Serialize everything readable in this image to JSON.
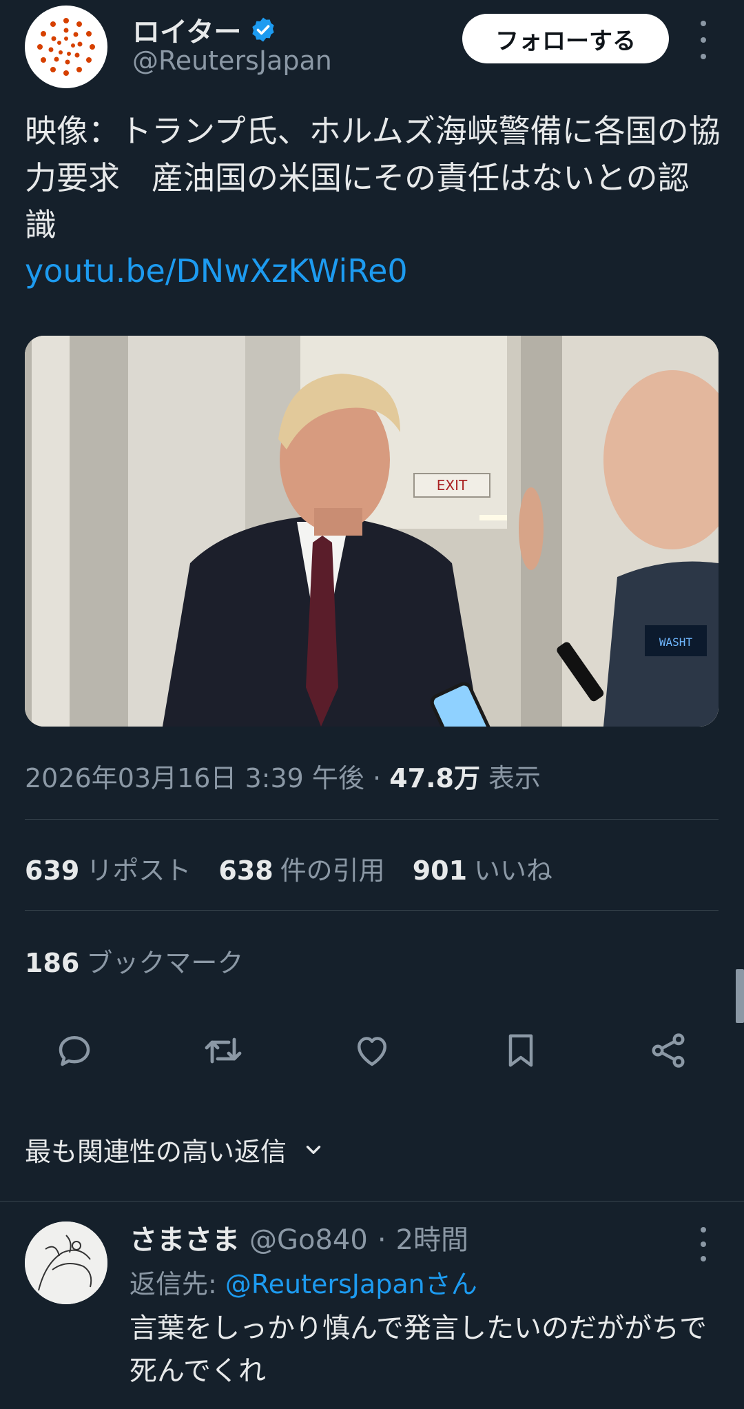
{
  "author": {
    "display_name": "ロイター",
    "handle": "@ReutersJapan",
    "verified": true,
    "follow_label": "フォローする",
    "brand_color": "#d64000"
  },
  "tweet": {
    "text": "映像：トランプ氏、ホルムズ海峡警備に各国の協力要求　産油国の米国にその責任はないとの認識",
    "link": "youtu.be/DNwXzKWiRe0",
    "media_sign_exit": "EXIT",
    "media_sign_screen": "WASHT",
    "timestamp": "2026年03月16日 3:39 午後",
    "separator": "·",
    "views_count": "47.8万",
    "views_label": "表示"
  },
  "stats": {
    "reposts": {
      "count": "639",
      "label": "リポスト"
    },
    "quotes": {
      "count": "638",
      "label": "件の引用"
    },
    "likes": {
      "count": "901",
      "label": "いいね"
    },
    "bookmarks": {
      "count": "186",
      "label": "ブックマーク"
    }
  },
  "actions": [
    "reply-icon",
    "repost-icon",
    "like-icon",
    "bookmark-icon",
    "share-icon"
  ],
  "replies_sort": {
    "label": "最も関連性の高い返信"
  },
  "reply": {
    "display_name": "さまさま",
    "handle": "@Go840",
    "separator": "·",
    "time": "2時間",
    "reply_to_prefix": "返信先:",
    "reply_to_handle": "@ReutersJapanさん",
    "text": "言葉をしっかり慎んで発言したいのだががちで死んでくれ"
  },
  "colors": {
    "background": "#15202b",
    "text": "#e7e9ea",
    "muted": "#8b98a5",
    "link": "#1d9bf0",
    "verified": "#1d9bf0",
    "divider": "#38444d"
  }
}
